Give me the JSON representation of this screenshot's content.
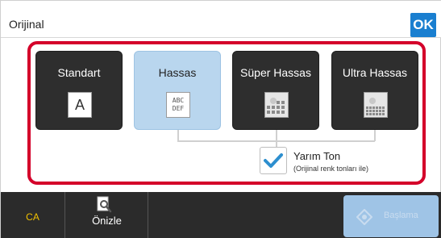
{
  "header": {
    "title": "Orijinal",
    "ok_label": "OK",
    "accent_color": "#1a7fd0"
  },
  "modes": [
    {
      "label": "Standart",
      "icon": "letter-a-icon",
      "icon_text": "A",
      "selected": false
    },
    {
      "label": "Hassas",
      "icon": "abc-def-icon",
      "icon_text_1": "ABC",
      "icon_text_2": "DEF",
      "selected": true
    },
    {
      "label": "Süper Hassas",
      "icon": "photo-grid-icon",
      "selected": false
    },
    {
      "label": "Ultra Hassas",
      "icon": "photo-grid-icon",
      "selected": false
    }
  ],
  "halftone": {
    "label": "Yarım Ton",
    "sublabel": "(Orijinal renk tonları ile)",
    "checked": true,
    "check_color": "#2d8fcf"
  },
  "highlight_color": "#d4002a",
  "bottom": {
    "ca_label": "CA",
    "preview_label": "Önizle",
    "start_label": "Başlama"
  }
}
